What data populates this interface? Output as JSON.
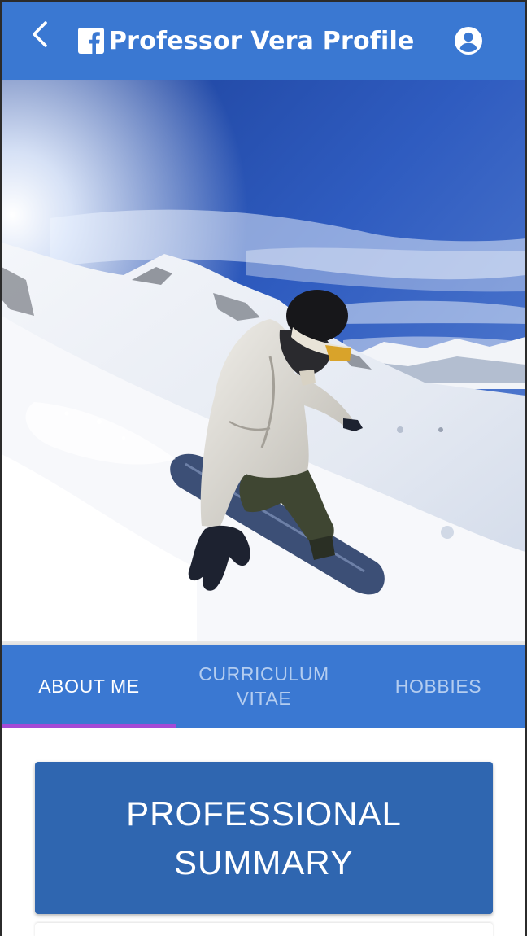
{
  "app_bar": {
    "back_icon": "chevron-left-icon",
    "brand_icon": "facebook-icon",
    "title": "Professor Vera Profile",
    "account_icon": "account-circle-icon",
    "background": "#3a78d2"
  },
  "hero": {
    "description_icon": "snowboarder-photo"
  },
  "tabs": {
    "items": [
      {
        "label": "ABOUT ME",
        "active": true
      },
      {
        "label": "CURRICULUM VITAE",
        "active": false
      },
      {
        "label": "HOBBIES",
        "active": false
      }
    ],
    "indicator_color": "#a44ad6"
  },
  "content": {
    "section_title": "PROFESSIONAL SUMMARY",
    "card_color": "#2f66b0"
  }
}
